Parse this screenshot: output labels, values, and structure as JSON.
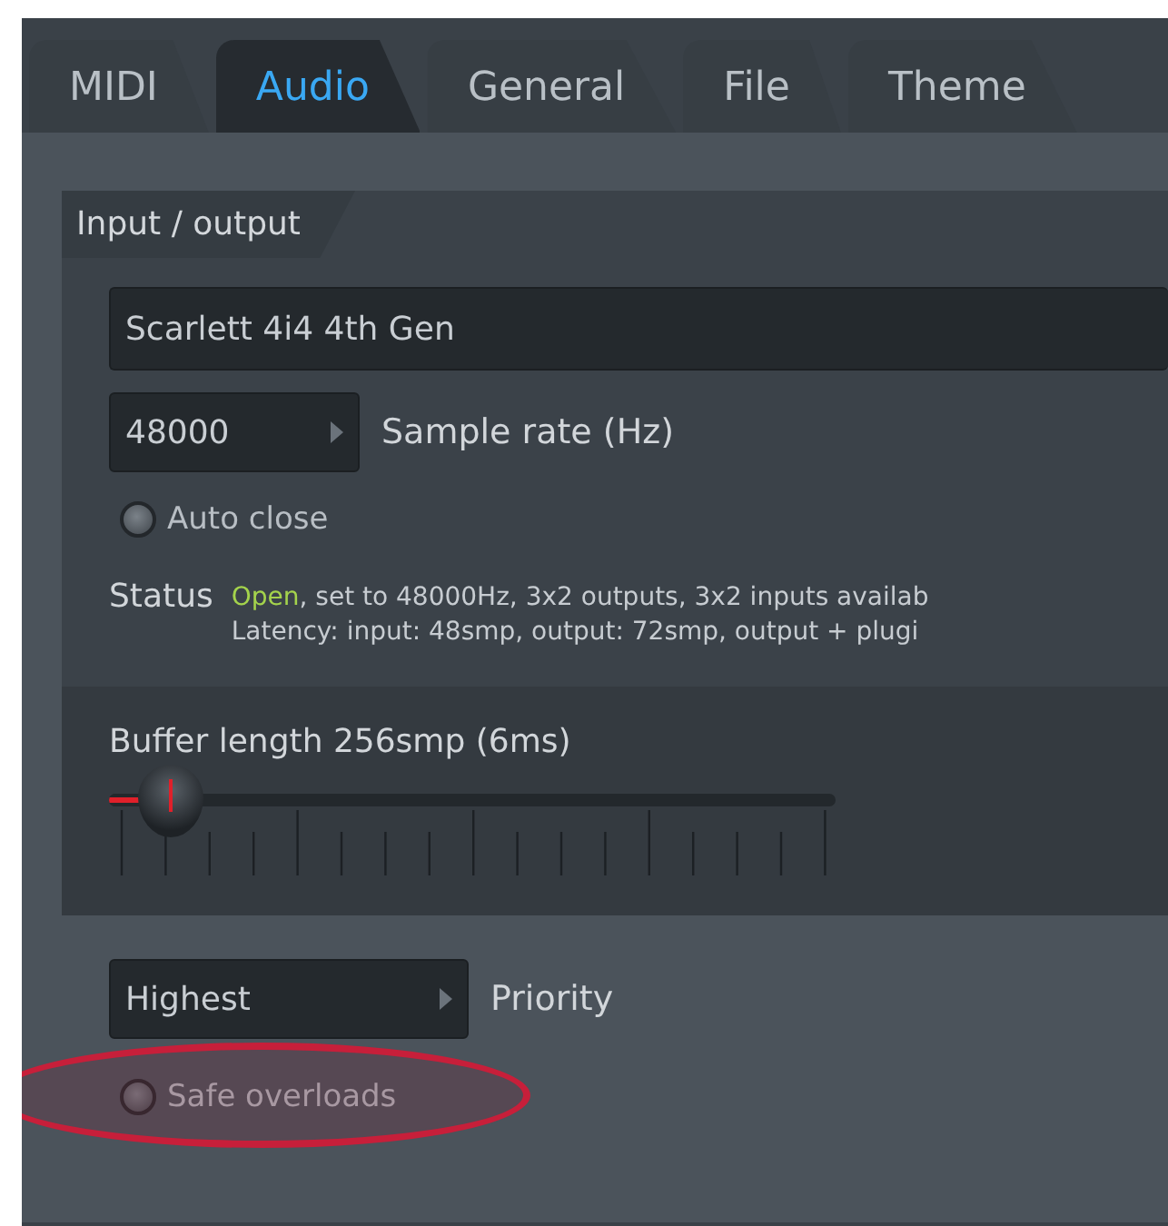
{
  "tabs": [
    {
      "label": "MIDI",
      "selected": false
    },
    {
      "label": "Audio",
      "selected": true
    },
    {
      "label": "General",
      "selected": false
    },
    {
      "label": "File",
      "selected": false
    },
    {
      "label": "Theme",
      "selected": false
    }
  ],
  "group": {
    "title": "Input / output",
    "device": {
      "value": "Scarlett 4i4 4th Gen"
    },
    "sample_rate": {
      "value": "48000",
      "label": "Sample rate (Hz)"
    },
    "auto_close": {
      "label": "Auto close",
      "checked": false
    },
    "status": {
      "label": "Status",
      "state": "Open",
      "line_1": ", set to 48000Hz, 3x2 outputs, 3x2 inputs availab",
      "line_2": "Latency: input: 48smp, output: 72smp, output + plugi"
    }
  },
  "buffer": {
    "label": "Buffer length 256smp (6ms)",
    "level": 0.06
  },
  "priority": {
    "value": "Highest",
    "label": "Priority"
  },
  "safe_overloads": {
    "label": "Safe overloads",
    "checked": false,
    "highlighted": true
  }
}
